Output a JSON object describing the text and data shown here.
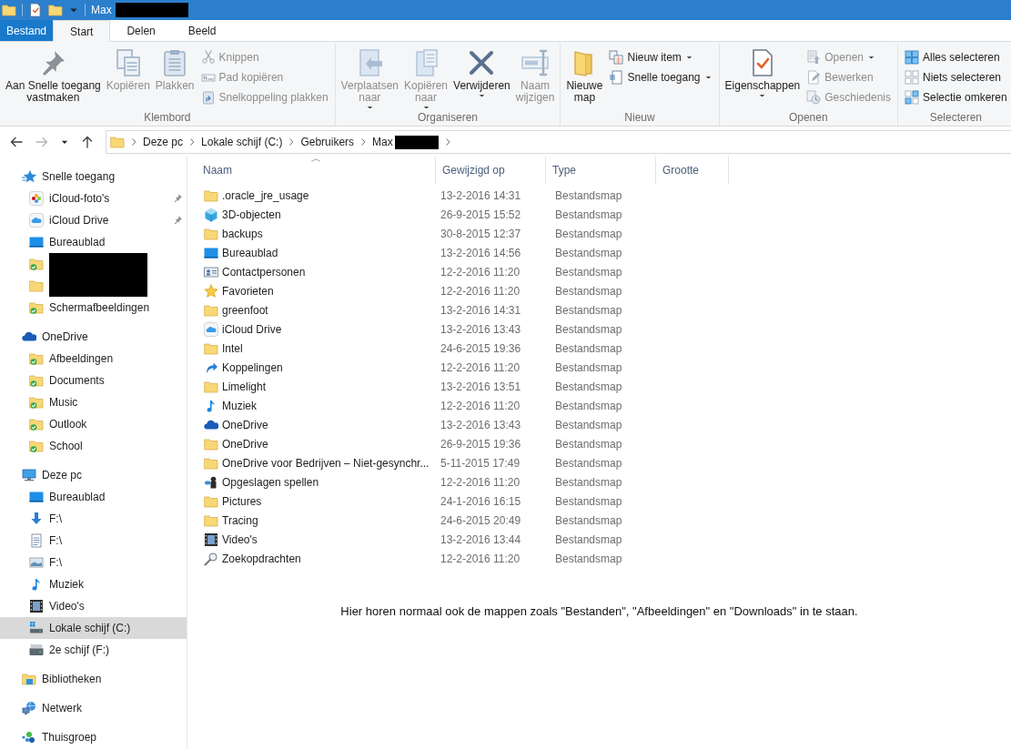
{
  "title_bar": {
    "title": "Max",
    "redacted": true
  },
  "tabs": [
    {
      "label": "Bestand",
      "kind": "file",
      "selected": false
    },
    {
      "label": "Start",
      "kind": "tab",
      "selected": true
    },
    {
      "label": "Delen",
      "kind": "tab",
      "selected": false
    },
    {
      "label": "Beeld",
      "kind": "tab",
      "selected": false
    }
  ],
  "ribbon": {
    "groups": [
      {
        "label": "Klembord",
        "controls": [
          {
            "kind": "large",
            "lines": [
              "Aan Snelle toegang",
              "vastmaken"
            ],
            "disabled": false,
            "dropdown": false
          },
          {
            "kind": "large",
            "lines": [
              "Kopiëren"
            ],
            "disabled": true,
            "dropdown": false
          },
          {
            "kind": "large",
            "lines": [
              "Plakken"
            ],
            "disabled": true,
            "dropdown": false
          },
          {
            "kind": "stack",
            "items": [
              {
                "label": "Knippen",
                "disabled": true,
                "dropdown": false
              },
              {
                "label": "Pad kopiëren",
                "disabled": true,
                "dropdown": false
              },
              {
                "label": "Snelkoppeling plakken",
                "disabled": true,
                "dropdown": false
              }
            ]
          }
        ]
      },
      {
        "label": "Organiseren",
        "controls": [
          {
            "kind": "large",
            "lines": [
              "Verplaatsen",
              "naar"
            ],
            "disabled": true,
            "dropdown": true
          },
          {
            "kind": "large",
            "lines": [
              "Kopiëren",
              "naar"
            ],
            "disabled": true,
            "dropdown": true
          },
          {
            "kind": "large",
            "lines": [
              "Verwijderen"
            ],
            "disabled": false,
            "dropdown": true
          },
          {
            "kind": "large",
            "lines": [
              "Naam",
              "wijzigen"
            ],
            "disabled": true,
            "dropdown": false
          }
        ]
      },
      {
        "label": "Nieuw",
        "controls": [
          {
            "kind": "large",
            "lines": [
              "Nieuwe",
              "map"
            ],
            "disabled": false,
            "dropdown": false
          },
          {
            "kind": "stack",
            "items": [
              {
                "label": "Nieuw item",
                "disabled": false,
                "dropdown": true
              },
              {
                "label": "Snelle toegang",
                "disabled": false,
                "dropdown": true
              }
            ]
          }
        ]
      },
      {
        "label": "Openen",
        "controls": [
          {
            "kind": "large",
            "lines": [
              "Eigenschappen"
            ],
            "disabled": false,
            "dropdown": true
          },
          {
            "kind": "stack",
            "items": [
              {
                "label": "Openen",
                "disabled": true,
                "dropdown": true
              },
              {
                "label": "Bewerken",
                "disabled": true,
                "dropdown": false
              },
              {
                "label": "Geschiedenis",
                "disabled": true,
                "dropdown": false
              }
            ]
          }
        ]
      },
      {
        "label": "Selecteren",
        "controls": [
          {
            "kind": "stack",
            "items": [
              {
                "label": "Alles selecteren",
                "disabled": false,
                "dropdown": false
              },
              {
                "label": "Niets selecteren",
                "disabled": false,
                "dropdown": false
              },
              {
                "label": "Selectie omkeren",
                "disabled": false,
                "dropdown": false
              }
            ]
          }
        ]
      }
    ]
  },
  "address_bar": {
    "forward_disabled": true,
    "crumbs": [
      "Deze pc",
      "Lokale schijf (C:)",
      "Gebruikers",
      "Max"
    ],
    "last_crumb_redacted": true
  },
  "sidebar": {
    "sections": [
      {
        "label": "Snelle toegang",
        "selected": false,
        "children": [
          {
            "label": "iCloud-foto's",
            "pinned": true,
            "redacted": false,
            "selected": false
          },
          {
            "label": "iCloud Drive",
            "pinned": true,
            "redacted": false,
            "selected": false
          },
          {
            "label": "Bureaublad",
            "pinned": false,
            "redacted": false,
            "selected": false
          },
          {
            "pinned": false,
            "redacted": true,
            "selected": false
          },
          {
            "pinned": false,
            "redacted": true,
            "selected": false
          },
          {
            "label": "Schermafbeeldingen",
            "pinned": false,
            "redacted": false,
            "selected": false
          }
        ]
      },
      {
        "label": "OneDrive",
        "selected": false,
        "children": [
          {
            "label": "Afbeeldingen",
            "selected": false
          },
          {
            "label": "Documents",
            "selected": false
          },
          {
            "label": "Music",
            "selected": false
          },
          {
            "label": "Outlook",
            "selected": false
          },
          {
            "label": "School",
            "selected": false
          }
        ]
      },
      {
        "label": "Deze pc",
        "selected": false,
        "children": [
          {
            "label": "Bureaublad",
            "selected": false
          },
          {
            "label": "F:\\",
            "selected": false
          },
          {
            "label": "F:\\",
            "selected": false
          },
          {
            "label": "F:\\",
            "selected": false
          },
          {
            "label": "Muziek",
            "selected": false
          },
          {
            "label": "Video's",
            "selected": false
          },
          {
            "label": "Lokale schijf (C:)",
            "selected": true
          },
          {
            "label": "2e schijf (F:)",
            "selected": false
          }
        ]
      },
      {
        "label": "Bibliotheken",
        "selected": false
      },
      {
        "label": "Netwerk",
        "selected": false
      },
      {
        "label": "Thuisgroep",
        "selected": false
      }
    ]
  },
  "file_list": {
    "columns": [
      {
        "label": "Naam",
        "sorted": true
      },
      {
        "label": "Gewijzigd op",
        "sorted": false
      },
      {
        "label": "Type",
        "sorted": false
      },
      {
        "label": "Grootte",
        "sorted": false
      }
    ],
    "rows": [
      {
        "name": ".oracle_jre_usage",
        "modified": "13-2-2016 14:31",
        "type": "Bestandsmap",
        "selected": false
      },
      {
        "name": "3D-objecten",
        "modified": "26-9-2015 15:52",
        "type": "Bestandsmap",
        "selected": false
      },
      {
        "name": "backups",
        "modified": "30-8-2015 12:37",
        "type": "Bestandsmap",
        "selected": false
      },
      {
        "name": "Bureaublad",
        "modified": "13-2-2016 14:56",
        "type": "Bestandsmap",
        "selected": false
      },
      {
        "name": "Contactpersonen",
        "modified": "12-2-2016 11:20",
        "type": "Bestandsmap",
        "selected": false
      },
      {
        "name": "Favorieten",
        "modified": "12-2-2016 11:20",
        "type": "Bestandsmap",
        "selected": false
      },
      {
        "name": "greenfoot",
        "modified": "13-2-2016 14:31",
        "type": "Bestandsmap",
        "selected": false
      },
      {
        "name": "iCloud Drive",
        "modified": "13-2-2016 13:43",
        "type": "Bestandsmap",
        "selected": false
      },
      {
        "name": "Intel",
        "modified": "24-6-2015 19:36",
        "type": "Bestandsmap",
        "selected": false
      },
      {
        "name": "Koppelingen",
        "modified": "12-2-2016 11:20",
        "type": "Bestandsmap",
        "selected": false
      },
      {
        "name": "Limelight",
        "modified": "13-2-2016 13:51",
        "type": "Bestandsmap",
        "selected": false
      },
      {
        "name": "Muziek",
        "modified": "12-2-2016 11:20",
        "type": "Bestandsmap",
        "selected": false
      },
      {
        "name": "OneDrive",
        "modified": "13-2-2016 13:43",
        "type": "Bestandsmap",
        "selected": false
      },
      {
        "name": "OneDrive",
        "modified": "26-9-2015 19:36",
        "type": "Bestandsmap",
        "selected": false
      },
      {
        "name": "OneDrive voor Bedrijven – Niet-gesynchr...",
        "modified": "5-11-2015 17:49",
        "type": "Bestandsmap",
        "selected": false
      },
      {
        "name": "Opgeslagen spellen",
        "modified": "12-2-2016 11:20",
        "type": "Bestandsmap",
        "selected": false
      },
      {
        "name": "Pictures",
        "modified": "24-1-2016 16:15",
        "type": "Bestandsmap",
        "selected": false
      },
      {
        "name": "Tracing",
        "modified": "24-6-2015 20:49",
        "type": "Bestandsmap",
        "selected": false
      },
      {
        "name": "Video's",
        "modified": "13-2-2016 13:44",
        "type": "Bestandsmap",
        "selected": false
      },
      {
        "name": "Zoekopdrachten",
        "modified": "12-2-2016 11:20",
        "type": "Bestandsmap",
        "selected": false
      }
    ],
    "note": "Hier horen normaal ook de mappen zoals \"Bestanden\", \"Afbeeldingen\" en \"Downloads\" in te staan."
  }
}
